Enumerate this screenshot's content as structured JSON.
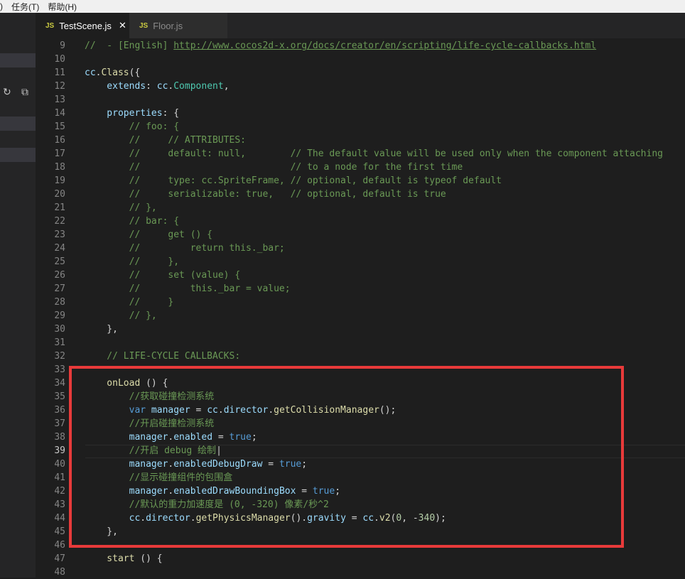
{
  "menubar": {
    "item_partial": ")",
    "tasks": "任务(T)",
    "help": "帮助(H)"
  },
  "tabs": [
    {
      "icon": "JS",
      "label": "TestScene.js",
      "close": "✕"
    },
    {
      "icon": "JS",
      "label": "Floor.js"
    }
  ],
  "sidebar": {
    "refresh_icon": "↻",
    "collapse_icon": "⧉"
  },
  "editor": {
    "current_line": 39,
    "lines": [
      {
        "n": "9",
        "tokens": [
          {
            "t": "//  - [English] ",
            "c": "t-comment"
          },
          {
            "t": "http://www.cocos2d-x.org/docs/creator/en/scripting/life-cycle-callbacks.html",
            "c": "t-link"
          }
        ]
      },
      {
        "n": "10",
        "tokens": []
      },
      {
        "n": "11",
        "tokens": [
          {
            "t": "cc",
            "c": "t-var"
          },
          {
            "t": ".",
            "c": "t-plain"
          },
          {
            "t": "Class",
            "c": "t-fn"
          },
          {
            "t": "({",
            "c": "t-plain"
          }
        ]
      },
      {
        "n": "12",
        "tokens": [
          {
            "t": "    extends",
            "c": "t-var"
          },
          {
            "t": ": ",
            "c": "t-plain"
          },
          {
            "t": "cc",
            "c": "t-var"
          },
          {
            "t": ".",
            "c": "t-plain"
          },
          {
            "t": "Component",
            "c": "t-cls"
          },
          {
            "t": ",",
            "c": "t-plain"
          }
        ]
      },
      {
        "n": "13",
        "tokens": []
      },
      {
        "n": "14",
        "tokens": [
          {
            "t": "    properties",
            "c": "t-var"
          },
          {
            "t": ": {",
            "c": "t-plain"
          }
        ]
      },
      {
        "n": "15",
        "tokens": [
          {
            "t": "        // foo: {",
            "c": "t-comment"
          }
        ]
      },
      {
        "n": "16",
        "tokens": [
          {
            "t": "        //     // ATTRIBUTES:",
            "c": "t-comment"
          }
        ]
      },
      {
        "n": "17",
        "tokens": [
          {
            "t": "        //     default: null,        // The default value will be used only when the component attaching",
            "c": "t-comment"
          }
        ]
      },
      {
        "n": "18",
        "tokens": [
          {
            "t": "        //                           // to a node for the first time",
            "c": "t-comment"
          }
        ]
      },
      {
        "n": "19",
        "tokens": [
          {
            "t": "        //     type: cc.SpriteFrame, // optional, default is typeof default",
            "c": "t-comment"
          }
        ]
      },
      {
        "n": "20",
        "tokens": [
          {
            "t": "        //     serializable: true,   // optional, default is true",
            "c": "t-comment"
          }
        ]
      },
      {
        "n": "21",
        "tokens": [
          {
            "t": "        // },",
            "c": "t-comment"
          }
        ]
      },
      {
        "n": "22",
        "tokens": [
          {
            "t": "        // bar: {",
            "c": "t-comment"
          }
        ]
      },
      {
        "n": "23",
        "tokens": [
          {
            "t": "        //     get () {",
            "c": "t-comment"
          }
        ]
      },
      {
        "n": "24",
        "tokens": [
          {
            "t": "        //         return this._bar;",
            "c": "t-comment"
          }
        ]
      },
      {
        "n": "25",
        "tokens": [
          {
            "t": "        //     },",
            "c": "t-comment"
          }
        ]
      },
      {
        "n": "26",
        "tokens": [
          {
            "t": "        //     set (value) {",
            "c": "t-comment"
          }
        ]
      },
      {
        "n": "27",
        "tokens": [
          {
            "t": "        //         this._bar = value;",
            "c": "t-comment"
          }
        ]
      },
      {
        "n": "28",
        "tokens": [
          {
            "t": "        //     }",
            "c": "t-comment"
          }
        ]
      },
      {
        "n": "29",
        "tokens": [
          {
            "t": "        // },",
            "c": "t-comment"
          }
        ]
      },
      {
        "n": "30",
        "tokens": [
          {
            "t": "    },",
            "c": "t-plain"
          }
        ]
      },
      {
        "n": "31",
        "tokens": []
      },
      {
        "n": "32",
        "tokens": [
          {
            "t": "    // LIFE-CYCLE CALLBACKS:",
            "c": "t-comment"
          }
        ]
      },
      {
        "n": "33",
        "tokens": []
      },
      {
        "n": "34",
        "tokens": [
          {
            "t": "    onLoad",
            "c": "t-fn"
          },
          {
            "t": " () {",
            "c": "t-plain"
          }
        ]
      },
      {
        "n": "35",
        "tokens": [
          {
            "t": "        //获取碰撞检测系统",
            "c": "t-comment"
          }
        ]
      },
      {
        "n": "36",
        "tokens": [
          {
            "t": "        var",
            "c": "t-kw"
          },
          {
            "t": " ",
            "c": "t-plain"
          },
          {
            "t": "manager",
            "c": "t-var"
          },
          {
            "t": " = ",
            "c": "t-plain"
          },
          {
            "t": "cc",
            "c": "t-var"
          },
          {
            "t": ".",
            "c": "t-plain"
          },
          {
            "t": "director",
            "c": "t-var"
          },
          {
            "t": ".",
            "c": "t-plain"
          },
          {
            "t": "getCollisionManager",
            "c": "t-fn"
          },
          {
            "t": "();",
            "c": "t-plain"
          }
        ]
      },
      {
        "n": "37",
        "tokens": [
          {
            "t": "        //开启碰撞检测系统",
            "c": "t-comment"
          }
        ]
      },
      {
        "n": "38",
        "tokens": [
          {
            "t": "        manager",
            "c": "t-var"
          },
          {
            "t": ".",
            "c": "t-plain"
          },
          {
            "t": "enabled",
            "c": "t-var"
          },
          {
            "t": " = ",
            "c": "t-plain"
          },
          {
            "t": "true",
            "c": "t-kw"
          },
          {
            "t": ";",
            "c": "t-plain"
          }
        ]
      },
      {
        "n": "39",
        "tokens": [
          {
            "t": "        //开启 debug 绘制",
            "c": "t-comment"
          },
          {
            "t": "|",
            "c": "t-plain"
          }
        ]
      },
      {
        "n": "40",
        "tokens": [
          {
            "t": "        manager",
            "c": "t-var"
          },
          {
            "t": ".",
            "c": "t-plain"
          },
          {
            "t": "enabledDebugDraw",
            "c": "t-var"
          },
          {
            "t": " = ",
            "c": "t-plain"
          },
          {
            "t": "true",
            "c": "t-kw"
          },
          {
            "t": ";",
            "c": "t-plain"
          }
        ]
      },
      {
        "n": "41",
        "tokens": [
          {
            "t": "        //显示碰撞组件的包围盒",
            "c": "t-comment"
          }
        ]
      },
      {
        "n": "42",
        "tokens": [
          {
            "t": "        manager",
            "c": "t-var"
          },
          {
            "t": ".",
            "c": "t-plain"
          },
          {
            "t": "enabledDrawBoundingBox",
            "c": "t-var"
          },
          {
            "t": " = ",
            "c": "t-plain"
          },
          {
            "t": "true",
            "c": "t-kw"
          },
          {
            "t": ";",
            "c": "t-plain"
          }
        ]
      },
      {
        "n": "43",
        "tokens": [
          {
            "t": "        //默认的重力加速度是 (0, -320) 像素/秒^2",
            "c": "t-comment"
          }
        ]
      },
      {
        "n": "44",
        "tokens": [
          {
            "t": "        cc",
            "c": "t-var"
          },
          {
            "t": ".",
            "c": "t-plain"
          },
          {
            "t": "director",
            "c": "t-var"
          },
          {
            "t": ".",
            "c": "t-plain"
          },
          {
            "t": "getPhysicsManager",
            "c": "t-fn"
          },
          {
            "t": "().",
            "c": "t-plain"
          },
          {
            "t": "gravity",
            "c": "t-var"
          },
          {
            "t": " = ",
            "c": "t-plain"
          },
          {
            "t": "cc",
            "c": "t-var"
          },
          {
            "t": ".",
            "c": "t-plain"
          },
          {
            "t": "v2",
            "c": "t-fn"
          },
          {
            "t": "(",
            "c": "t-plain"
          },
          {
            "t": "0",
            "c": "t-num"
          },
          {
            "t": ", -",
            "c": "t-plain"
          },
          {
            "t": "340",
            "c": "t-num"
          },
          {
            "t": ");",
            "c": "t-plain"
          }
        ]
      },
      {
        "n": "45",
        "tokens": [
          {
            "t": "    },",
            "c": "t-plain"
          }
        ]
      },
      {
        "n": "46",
        "tokens": []
      },
      {
        "n": "47",
        "tokens": [
          {
            "t": "    start",
            "c": "t-fn"
          },
          {
            "t": " () {",
            "c": "t-plain"
          }
        ]
      },
      {
        "n": "48",
        "tokens": []
      }
    ]
  }
}
